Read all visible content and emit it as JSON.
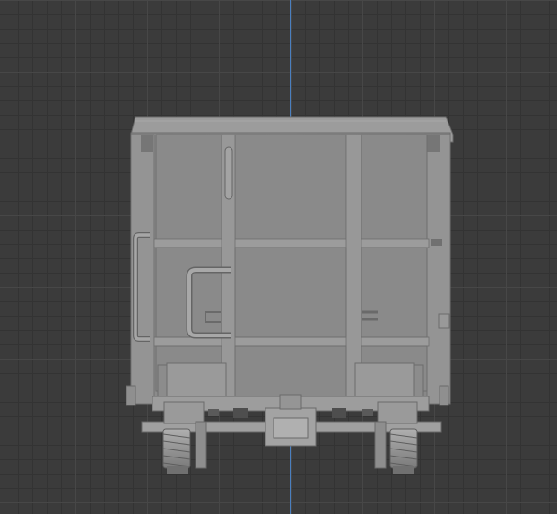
{
  "viewport": {
    "background": "#3b3b3b",
    "grid_minor_color": "#333333",
    "grid_major_color": "#474747",
    "axis_color": "#4a7fbf",
    "axis": "z"
  },
  "model": {
    "object": "wagon-end-view",
    "shading": "solid",
    "body_color": "#8d8d8d",
    "panel_color": "#868686",
    "frame_color": "#9a9a9a",
    "shadow_color": "#6f6f6f"
  }
}
